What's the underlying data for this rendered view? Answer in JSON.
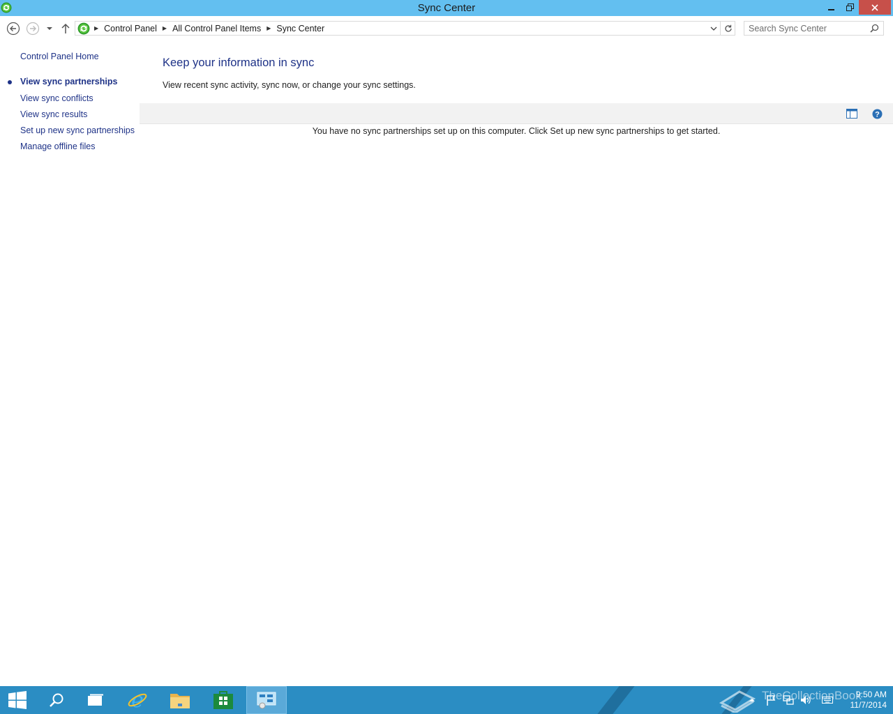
{
  "window": {
    "title": "Sync Center",
    "minimize_label": "—",
    "maximize_label": "❐",
    "close_label": "✕"
  },
  "address": {
    "breadcrumbs": [
      "Control Panel",
      "All Control Panel Items",
      "Sync Center"
    ]
  },
  "search": {
    "placeholder": "Search Sync Center"
  },
  "sidebar": {
    "home": "Control Panel Home",
    "items": [
      {
        "label": "View sync partnerships",
        "active": true
      },
      {
        "label": "View sync conflicts",
        "active": false
      },
      {
        "label": "View sync results",
        "active": false
      },
      {
        "label": "Set up new sync partnerships",
        "active": false
      },
      {
        "label": "Manage offline files",
        "active": false
      }
    ]
  },
  "main": {
    "heading": "Keep your information in sync",
    "subtext": "View recent sync activity, sync now, or change your sync settings.",
    "empty_message": "You have no sync partnerships set up on this computer. Click Set up new sync partnerships to get started."
  },
  "taskbar": {
    "watermark": "TheCollectionBook",
    "time": "9:50 AM",
    "date": "11/7/2014"
  },
  "colors": {
    "titlebar": "#63bff0",
    "link": "#1e3287",
    "close": "#c7504a",
    "taskbar": "#2b8dc3"
  }
}
